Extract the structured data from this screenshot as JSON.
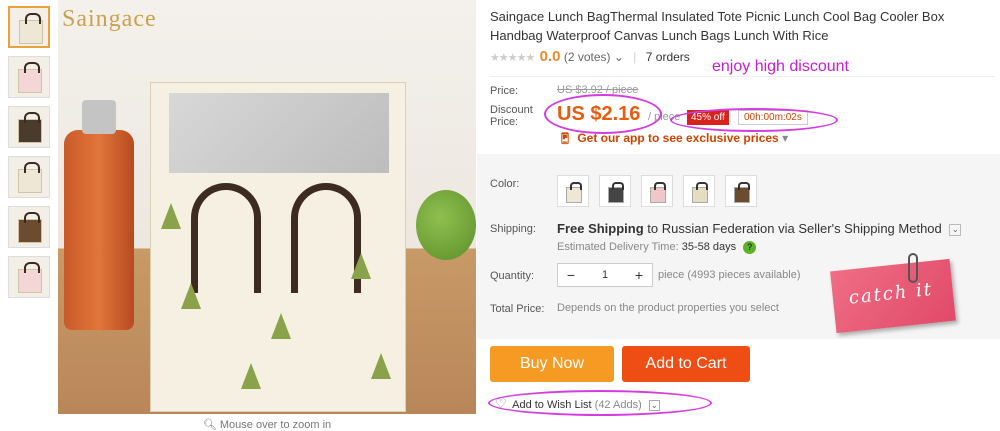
{
  "gallery": {
    "brand": "Saingace",
    "zoom_hint": "Mouse over to zoom in"
  },
  "product": {
    "title": "Saingace Lunch BagThermal Insulated Tote Picnic Lunch Cool Bag Cooler Box Handbag Waterproof Canvas Lunch Bags Lunch With Rice",
    "rating": "0.0",
    "votes": "(2 votes)",
    "orders": "7 orders",
    "stars": "★★★★★"
  },
  "price": {
    "price_label": "Price:",
    "original": "US $3.92 / piece",
    "discount_label_1": "Discount",
    "discount_label_2": "Price:",
    "discount_value": "US $2.16",
    "per_piece": "/ piece",
    "off": "45% off",
    "timer": "00h:00m:02s",
    "app_promo": "Get our app to see exclusive prices",
    "app_promo_arrow": "▾"
  },
  "annotations": {
    "banner": "enjoy high discount",
    "sticker": "catch it",
    "color": "#d43ce0"
  },
  "options": {
    "color_label": "Color:",
    "shipping_label": "Shipping:",
    "shipping_free": "Free Shipping",
    "shipping_to": "to",
    "shipping_dest": "Russian Federation",
    "shipping_via": "via Seller's Shipping Method",
    "est_label": "Estimated Delivery Time:",
    "est_value": "35-58 days",
    "quantity_label": "Quantity:",
    "quantity_value": "1",
    "quantity_info": "piece (4993 pieces available)",
    "total_label": "Total Price:",
    "total_note": "Depends on the product properties you select"
  },
  "actions": {
    "buy_now": "Buy Now",
    "add_to_cart": "Add to Cart",
    "wish_list": "Add to Wish List",
    "wish_count": "(42 Adds)"
  }
}
